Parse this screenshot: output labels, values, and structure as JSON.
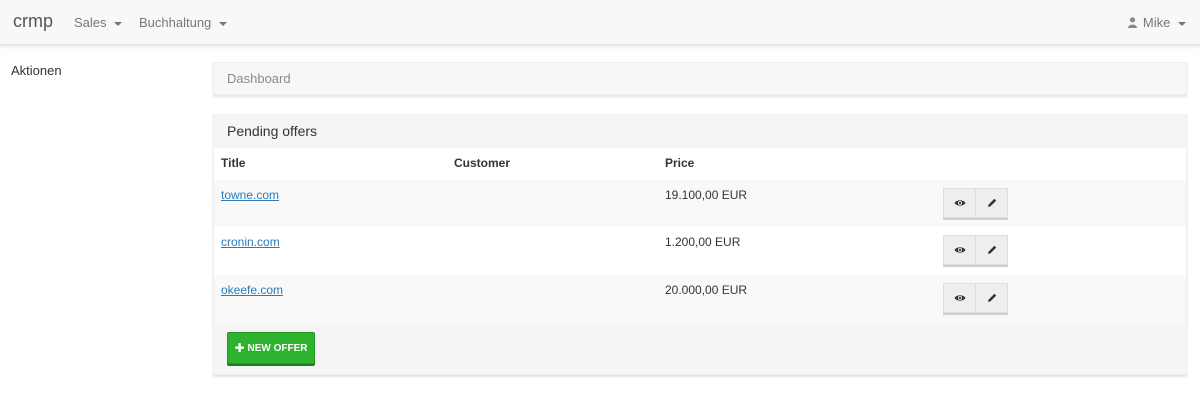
{
  "navbar": {
    "brand": "crmp",
    "menu": [
      {
        "label": "Sales"
      },
      {
        "label": "Buchhaltung"
      }
    ],
    "user": {
      "label": "Mike",
      "icon": "user-icon"
    }
  },
  "sidebar": {
    "title": "Aktionen"
  },
  "breadcrumb": {
    "current": "Dashboard"
  },
  "offers": {
    "title": "Pending offers",
    "columns": [
      "Title",
      "Customer",
      "Price"
    ],
    "rows": [
      {
        "title": "towne.com",
        "customer": "",
        "price": "19.100,00 EUR"
      },
      {
        "title": "cronin.com",
        "customer": "",
        "price": "1.200,00 EUR"
      },
      {
        "title": "okeefe.com",
        "customer": "",
        "price": "20.000,00 EUR"
      }
    ],
    "row_actions": [
      {
        "icon": "eye-icon"
      },
      {
        "icon": "pencil-icon"
      }
    ],
    "new_button": {
      "label": "NEW OFFER",
      "icon": "plus-icon"
    }
  },
  "colors": {
    "navbar_bg": "#f8f8f8",
    "link": "#2a7bb8",
    "success": "#2db32d"
  }
}
